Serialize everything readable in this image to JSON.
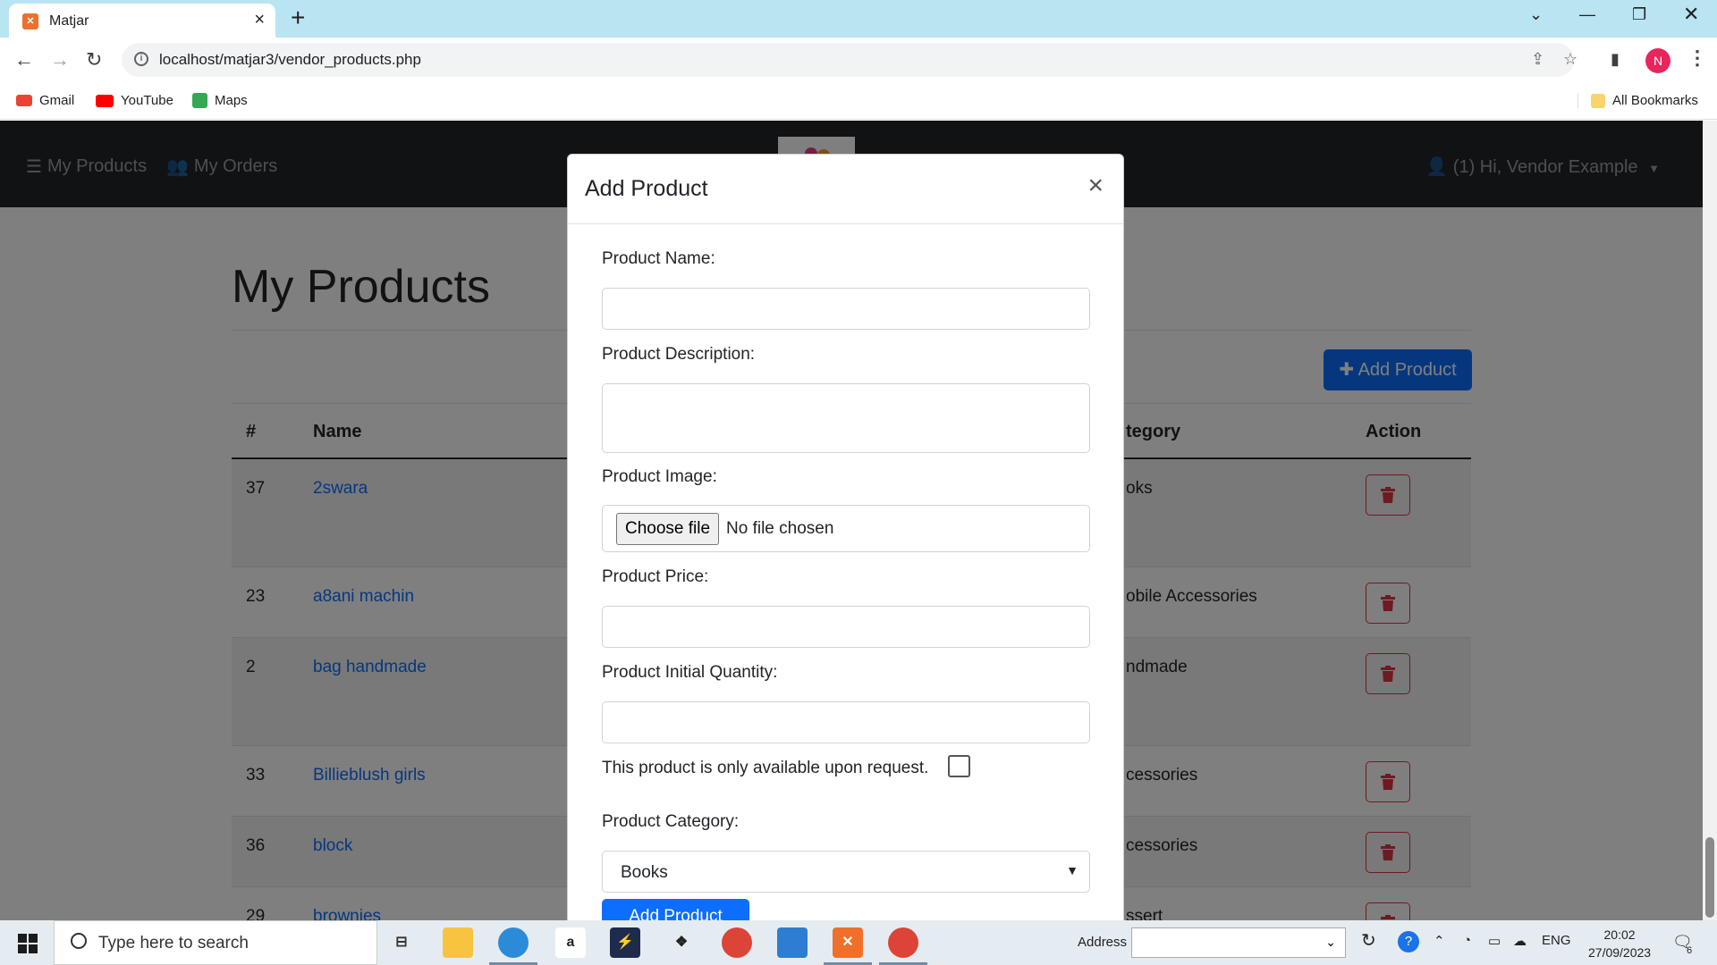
{
  "browser": {
    "tab_title": "Matjar",
    "tab_favicon": "xampp-icon",
    "url": "localhost/matjar3/vendor_products.php",
    "profile_initial": "N",
    "bookmarks": [
      {
        "label": "Gmail",
        "icon": "gmail-icon",
        "color": "#ea4335"
      },
      {
        "label": "YouTube",
        "icon": "youtube-icon",
        "color": "#ff0000"
      },
      {
        "label": "Maps",
        "icon": "maps-icon",
        "color": "#34a853"
      }
    ],
    "all_bookmarks": "All Bookmarks"
  },
  "nav": {
    "my_products": "My Products",
    "my_orders": "My Orders",
    "user_menu": "(1) Hi, Vendor Example"
  },
  "page": {
    "title": "My Products",
    "add_button": "Add Product",
    "table": {
      "headers": {
        "id": "#",
        "name": "Name",
        "category": "tegory",
        "action": "Action"
      },
      "rows": [
        {
          "id": "37",
          "name": "2swara",
          "category": "oks",
          "striped": true
        },
        {
          "id": "23",
          "name": "a8ani machin",
          "category": "obile Accessories",
          "striped": false
        },
        {
          "id": "2",
          "name": "bag handmade",
          "category": "ndmade",
          "striped": true
        },
        {
          "id": "33",
          "name": "Billieblush girls",
          "category": "cessories",
          "striped": false
        },
        {
          "id": "36",
          "name": "block",
          "category": "cessories",
          "striped": true
        },
        {
          "id": "29",
          "name": "brownies",
          "category": "ssert",
          "striped": false
        }
      ]
    }
  },
  "modal": {
    "title": "Add Product",
    "close": "×",
    "fields": {
      "name_label": "Product Name:",
      "name_value": "",
      "description_label": "Product Description:",
      "description_value": "",
      "image_label": "Product Image:",
      "choose_file": "Choose file",
      "no_file": "No file chosen",
      "price_label": "Product Price:",
      "price_value": "",
      "quantity_label": "Product Initial Quantity:",
      "quantity_value": "",
      "request_only_label": "This product is only available upon request.",
      "request_only_checked": false,
      "category_label": "Product Category:",
      "category_value": "Books"
    },
    "submit": "Add Product"
  },
  "taskbar": {
    "search_placeholder": "Type here to search",
    "address_label": "Address",
    "language": "ENG",
    "time": "20:02",
    "date": "27/09/2023",
    "notification_count": "6",
    "apps": [
      "task-view-icon",
      "file-explorer-icon",
      "edge-icon",
      "amazon-icon",
      "powershell-icon",
      "dropbox-icon",
      "chrome-icon",
      "store-icon",
      "xampp-icon",
      "chrome-profile-icon"
    ]
  }
}
